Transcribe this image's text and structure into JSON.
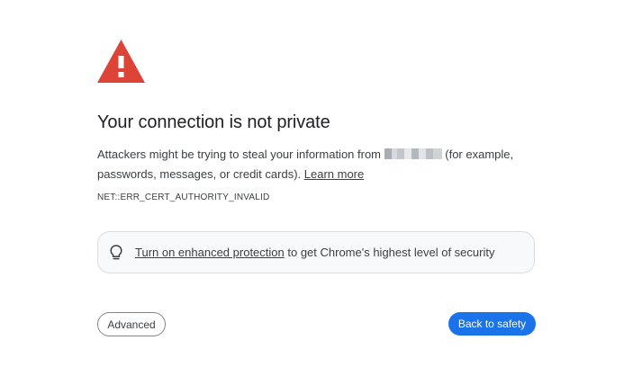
{
  "page": {
    "title": "Your connection is not private",
    "description_before": "Attackers might be trying to steal your information from ",
    "description_after": " (for example, passwords, messages, or credit cards). ",
    "learn_more": "Learn more",
    "error_code": "NET::ERR_CERT_AUTHORITY_INVALID"
  },
  "enhanced": {
    "icon": "lightbulb-icon",
    "link": "Turn on enhanced protection",
    "text": " to get Chrome's highest level of security"
  },
  "buttons": {
    "advanced": "Advanced",
    "back_to_safety": "Back to safety"
  },
  "colors": {
    "warning_red": "#db4437",
    "primary_blue": "#1a73e8",
    "text": "#202124",
    "box_bg": "#f8f9fa"
  },
  "icons": {
    "warning": "warning-triangle-icon"
  }
}
